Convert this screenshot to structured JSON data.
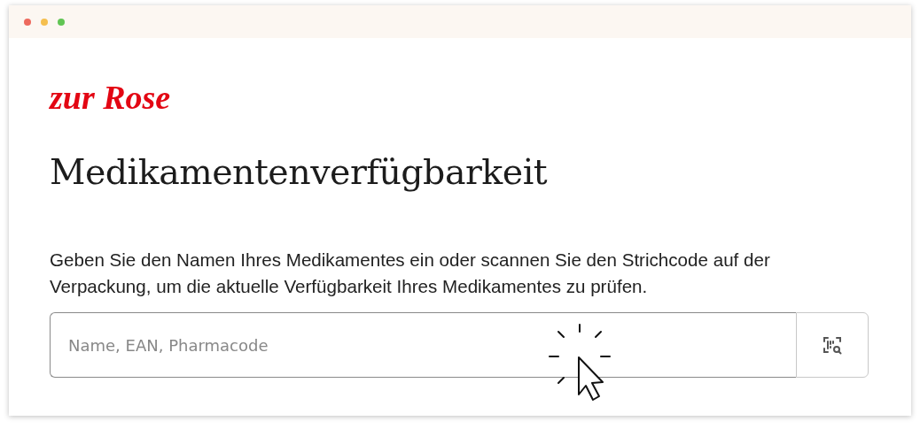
{
  "logo": "zur Rose",
  "title": "Medikamentenverfügbarkeit",
  "description": "Geben Sie den Namen Ihres Medikamentes ein oder scannen Sie den Strichcode auf der Verpackung, um die aktuelle Verfügbarkeit Ihres Medikamentes zu prüfen.",
  "search": {
    "placeholder": "Name, EAN, Pharmacode"
  }
}
